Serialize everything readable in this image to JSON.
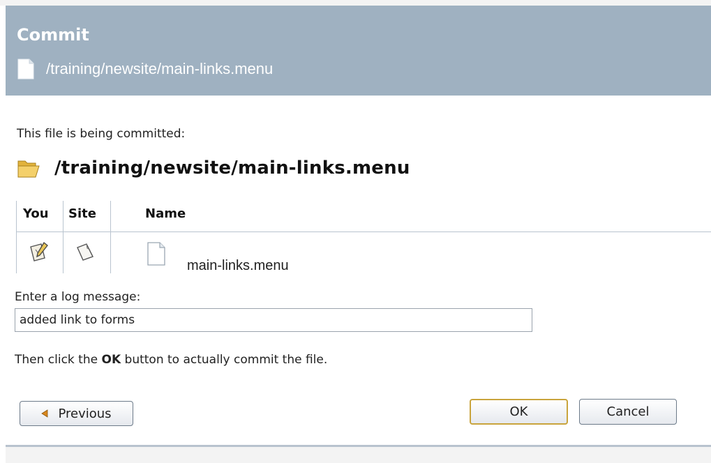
{
  "header": {
    "title": "Commit",
    "path": "/training/newsite/main-links.menu",
    "file_icon": "document-icon"
  },
  "main": {
    "intro": "This file is being committed:",
    "path_heading": "/training/newsite/main-links.menu",
    "folder_icon": "open-folder-icon",
    "table": {
      "columns": [
        "You",
        "Site",
        "Name"
      ],
      "rows": [
        {
          "you_status_icon": "edited-file-icon",
          "site_status_icon": "file-icon",
          "name": "main-links.menu"
        }
      ]
    },
    "log": {
      "label": "Enter a log message:",
      "value": "added link to forms"
    },
    "instructions": {
      "before": "Then click the ",
      "emphasis": "OK",
      "after": " button to actually commit the file."
    }
  },
  "buttons": {
    "previous": "Previous",
    "ok": "OK",
    "cancel": "Cancel"
  },
  "colors": {
    "header_bg": "#9fb1c1",
    "ok_border": "#c9a43c"
  }
}
